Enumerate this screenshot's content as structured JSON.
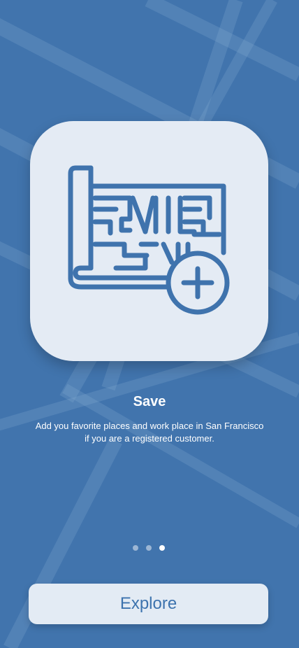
{
  "screen": {
    "theme": {
      "background": "#4174AD",
      "card_background": "#E4EBF4",
      "accent": "#3D73AE"
    },
    "illustration": {
      "icon": "map-save-icon"
    },
    "title": "Save",
    "description": "Add you favorite places and work place in San Francisco\nif you are a registered customer.",
    "pager": {
      "total_pages": 3,
      "current_page": 3
    },
    "button": {
      "label": "Explore"
    }
  }
}
